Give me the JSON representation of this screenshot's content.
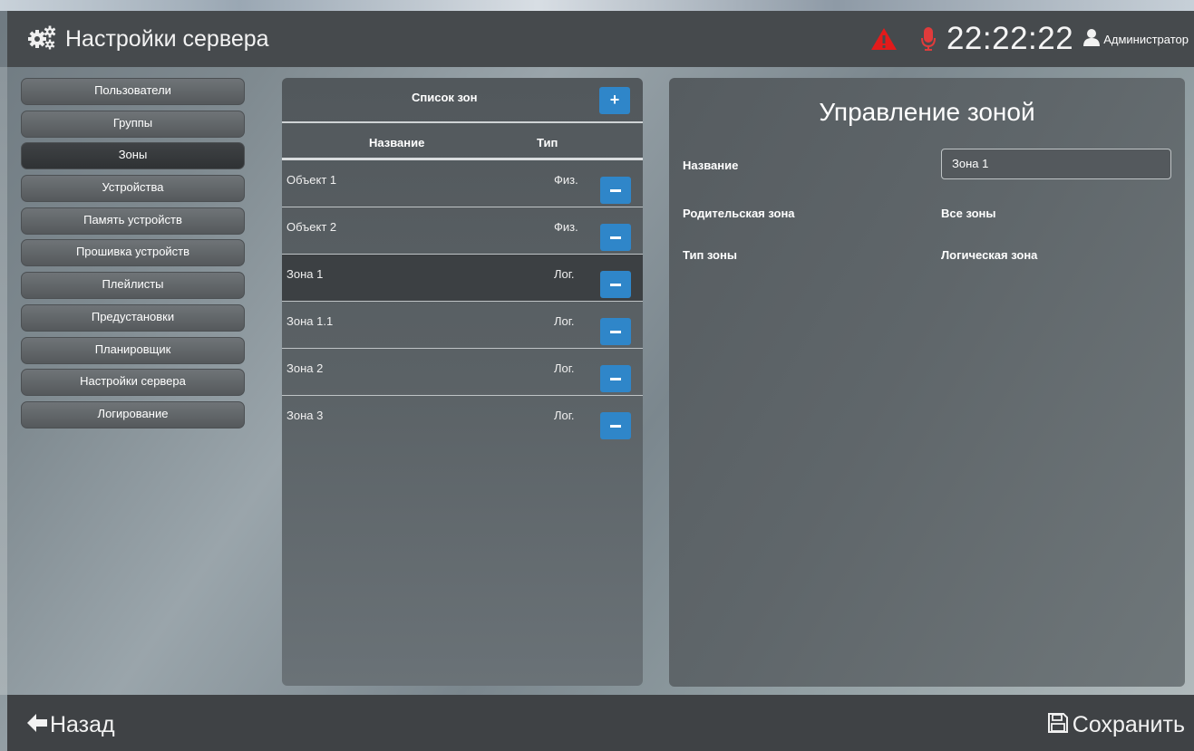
{
  "header": {
    "title": "Настройки сервера",
    "clock": "22:22:22",
    "user": "Администратор",
    "icons": {
      "settings": "gears-icon",
      "alert": "warning-icon",
      "mic": "microphone-icon",
      "user": "user-icon"
    },
    "colors": {
      "alert": "#e21b1b",
      "mic": "#e03b3b"
    }
  },
  "sidebar": {
    "items": [
      {
        "label": "Пользователи"
      },
      {
        "label": "Группы"
      },
      {
        "label": "Зоны",
        "active": true
      },
      {
        "label": "Устройства"
      },
      {
        "label": "Память устройств"
      },
      {
        "label": "Прошивка устройств"
      },
      {
        "label": "Плейлисты"
      },
      {
        "label": "Предустановки"
      },
      {
        "label": "Планировщик"
      },
      {
        "label": "Настройки сервера"
      },
      {
        "label": "Логирование"
      }
    ]
  },
  "zones": {
    "title": "Список зон",
    "add_label": "+",
    "columns": {
      "name": "Название",
      "type": "Тип"
    },
    "rows": [
      {
        "name": "Объект 1",
        "type": "Физ."
      },
      {
        "name": "Объект 2",
        "type": "Физ."
      },
      {
        "name": "Зона 1",
        "type": "Лог.",
        "selected": true
      },
      {
        "name": "Зона 1.1",
        "type": "Лог."
      },
      {
        "name": "Зона 2",
        "type": "Лог."
      },
      {
        "name": "Зона 3",
        "type": "Лог."
      }
    ],
    "button_color": "#2f86c9"
  },
  "manage": {
    "title": "Управление зоной",
    "name_label": "Название",
    "name_value": "Зона 1",
    "parent_label": "Родительская зона",
    "parent_value": "Все зоны",
    "type_label": "Тип зоны",
    "type_value": "Логическая зона"
  },
  "footer": {
    "back_label": "Назад",
    "save_label": "Сохранить",
    "icons": {
      "back": "arrow-left-icon",
      "save": "floppy-disk-icon"
    }
  }
}
